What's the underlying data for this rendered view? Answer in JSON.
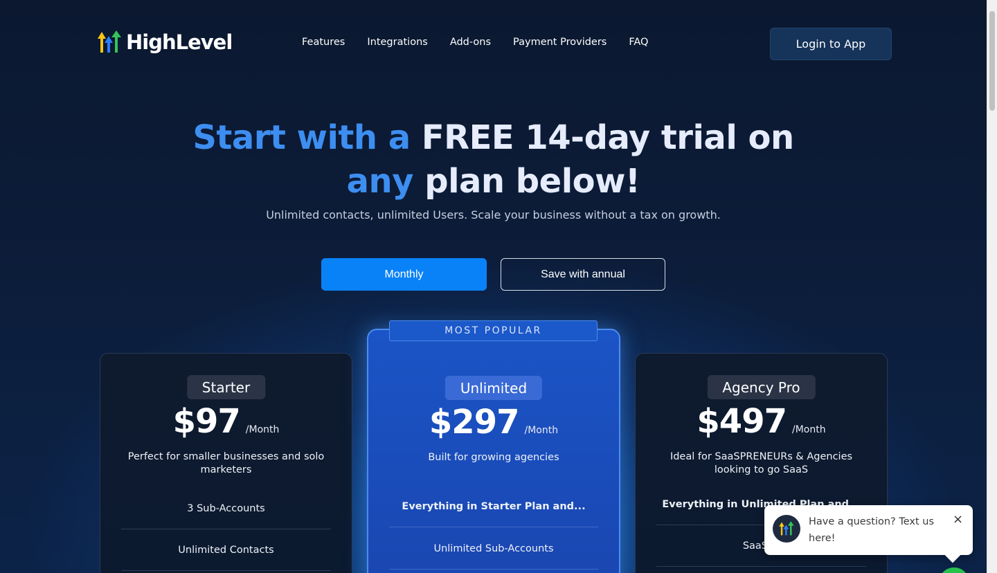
{
  "header": {
    "logo_text": "HighLevel",
    "nav": [
      "Features",
      "Integrations",
      "Add-ons",
      "Payment Providers",
      "FAQ"
    ],
    "login_label": "Login to App"
  },
  "hero": {
    "title_part1": "Start with a",
    "title_part2": "FREE 14-day trial on",
    "title_part3": "any",
    "title_part4": "plan below!",
    "subtitle": "Unlimited contacts, unlimited Users. Scale your business without a tax on growth."
  },
  "billing_toggle": {
    "monthly": "Monthly",
    "annual": "Save with annual"
  },
  "popular_tag": "MOST POPULAR",
  "plans": [
    {
      "name": "Starter",
      "price": "$97",
      "per": "/Month",
      "description": "Perfect for smaller businesses and solo marketers",
      "features": [
        "3 Sub-Accounts",
        "Unlimited Contacts"
      ]
    },
    {
      "name": "Unlimited",
      "price": "$297",
      "per": "/Month",
      "description": "Built for growing agencies",
      "features": [
        "Everything in Starter Plan and...",
        "Unlimited Sub-Accounts"
      ]
    },
    {
      "name": "Agency Pro",
      "price": "$497",
      "per": "/Month",
      "description": "Ideal for SaaSPRENEURs & Agencies looking to go SaaS",
      "features": [
        "Everything in Unlimited Plan and...",
        "SaaS M"
      ]
    }
  ],
  "chat": {
    "message": "Have a question? Text us here!",
    "close": "×"
  },
  "colors": {
    "accent_blue": "#0a82f7",
    "title_blue": "#3d8ef0",
    "popular_card": "#1b54c6",
    "chat_bubble": "#27c24c"
  }
}
